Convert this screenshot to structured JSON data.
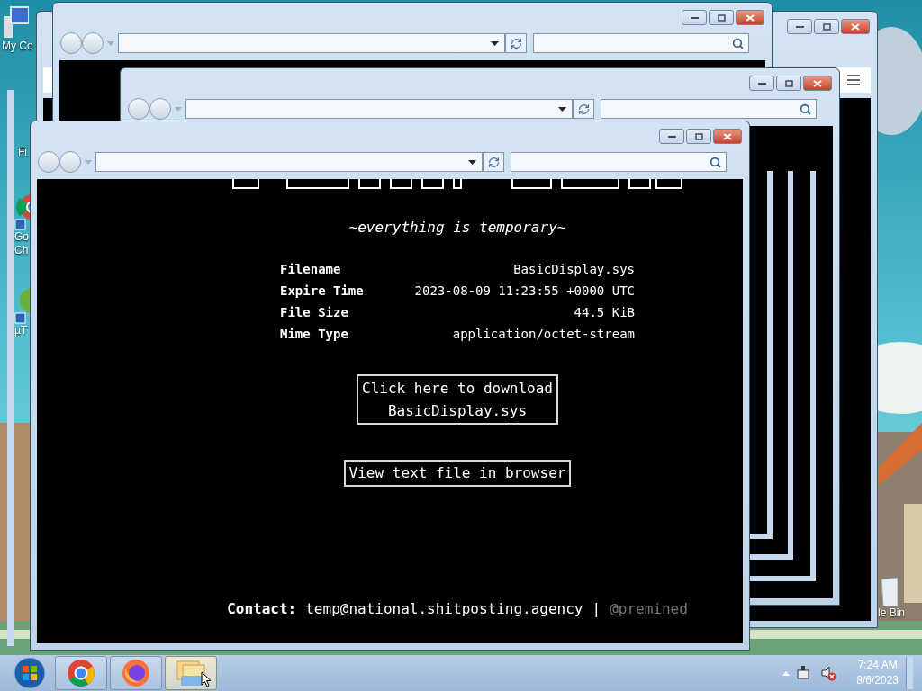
{
  "desktop_icons": [
    {
      "kind": "computer",
      "lines": [
        "My Co"
      ]
    },
    {
      "kind": "folder",
      "lines": [
        "Fi"
      ]
    },
    {
      "kind": "chrome",
      "lines": [
        "Go",
        "Ch"
      ]
    },
    {
      "kind": "torrent",
      "lines": [
        "µT"
      ]
    },
    {
      "kind": "bin",
      "lines": [
        "le Bin"
      ]
    }
  ],
  "page": {
    "tagline": "~everything is temporary~",
    "details": [
      {
        "label": "Filename",
        "value": "BasicDisplay.sys"
      },
      {
        "label": "Expire Time",
        "value": "2023-08-09 11:23:55 +0000 UTC"
      },
      {
        "label": "File Size",
        "value": "44.5 KiB"
      },
      {
        "label": "Mime Type",
        "value": "application/octet-stream"
      }
    ],
    "download_button": {
      "lines": [
        "Click here to download",
        "BasicDisplay.sys"
      ]
    },
    "view_button": "View text file in browser",
    "contact": {
      "label": "Contact:",
      "email": "temp@national.shitposting.agency",
      "separator": "|",
      "handle": "@premined"
    }
  },
  "taskbar": {
    "apps": [
      {
        "kind": "chrome",
        "selected": false
      },
      {
        "kind": "firefox",
        "selected": false
      },
      {
        "kind": "explorer",
        "selected": true
      }
    ],
    "tray": {
      "volume_muted": true
    },
    "clock": {
      "time": "7:24 AM",
      "date": "8/6/2023"
    }
  }
}
